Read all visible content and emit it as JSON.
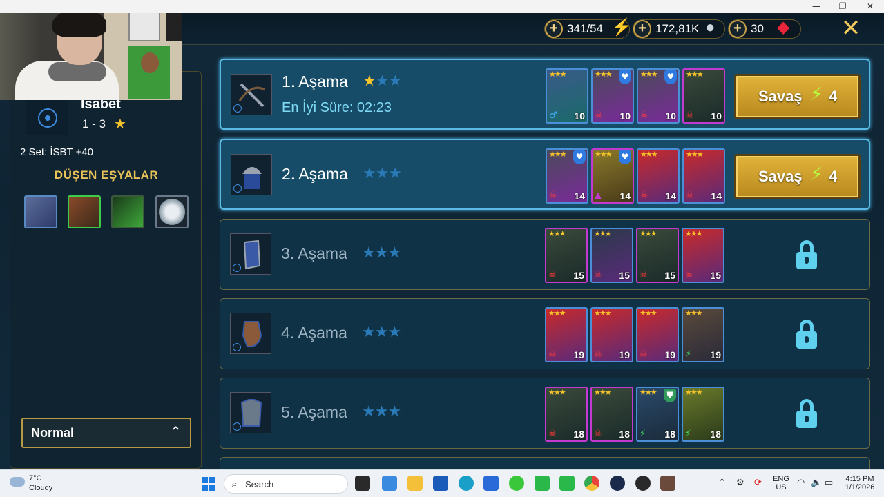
{
  "window": {
    "minimize": "—",
    "maximize": "❐",
    "close": "✕"
  },
  "resources": {
    "energy": "341/54",
    "silver": "172,81K",
    "gems": "30",
    "plus": "+"
  },
  "left_panel": {
    "stat_name": "İsabet",
    "stat_range": "1 - 3",
    "set_bonus": "2 Set: İSBT +40",
    "drops_title": "DÜŞEN EŞYALAR",
    "mode": "Normal"
  },
  "stages": [
    {
      "name": "1. Aşama",
      "best_time": "En İyi Süre: 02:23",
      "stars_filled": 1,
      "battle_label": "Savaş",
      "cost": "4",
      "enemy_levels": [
        "10",
        "10",
        "10",
        "10"
      ]
    },
    {
      "name": "2. Aşama",
      "stars_filled": 0,
      "battle_label": "Savaş",
      "cost": "4",
      "enemy_levels": [
        "14",
        "14",
        "14",
        "14"
      ]
    },
    {
      "name": "3. Aşama",
      "stars_filled": 0,
      "locked": true,
      "enemy_levels": [
        "15",
        "15",
        "15",
        "15"
      ]
    },
    {
      "name": "4. Aşama",
      "stars_filled": 0,
      "locked": true,
      "enemy_levels": [
        "19",
        "19",
        "19",
        "19"
      ]
    },
    {
      "name": "5. Aşama",
      "stars_filled": 0,
      "locked": true,
      "enemy_levels": [
        "18",
        "18",
        "18",
        "18"
      ]
    }
  ],
  "taskbar": {
    "temp": "7°C",
    "condition": "Cloudy",
    "search_placeholder": "Search",
    "lang": "ENG",
    "region": "US",
    "time": "4:15 PM",
    "date": "1/1/2026"
  },
  "colors": {
    "accent": "#5bbbe6",
    "gold": "#e1b43a",
    "star": "#f4c22b",
    "lock": "#5fd0ee"
  }
}
